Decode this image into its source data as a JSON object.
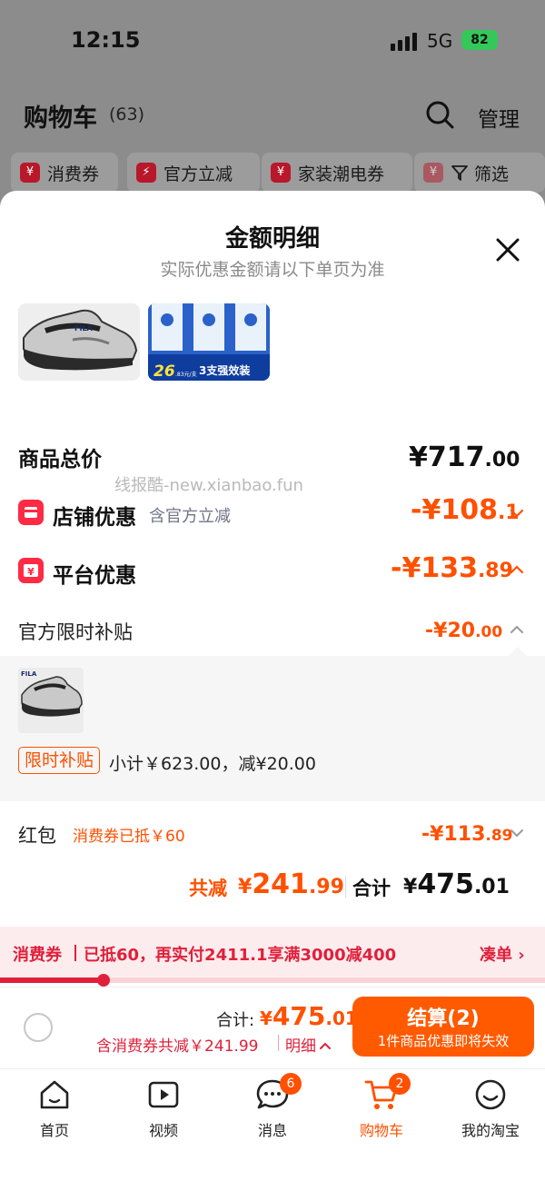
{
  "status_bar": {
    "time": "12:15",
    "network": "5G",
    "battery": "82"
  },
  "cart": {
    "title": "购物车",
    "count": "(63)",
    "manage": "管理",
    "chips": [
      "消费券",
      "官方立减",
      "家装潮电券",
      "筛选"
    ]
  },
  "sheet": {
    "title": "金额明细",
    "subtitle": "实际优惠金额请以下单页为准",
    "tooth_thumb_price": "26",
    "tooth_thumb_unit": ".83元/支",
    "tooth_thumb_caption": "3支强效装"
  },
  "watermark": "线报酷-new.xianbao.fun",
  "goods_total": {
    "label": "商品总价",
    "symbol": "¥",
    "int": "717",
    "dec": ".00"
  },
  "shop_discount": {
    "label": "店铺优惠",
    "note": "含官方立减",
    "prefix": "-¥",
    "int": "108",
    "dec": ".1"
  },
  "platform_discount": {
    "label": "平台优惠",
    "prefix": "-¥",
    "int": "133",
    "dec": ".89"
  },
  "subsidy": {
    "label": "官方限时补贴",
    "prefix": "-¥",
    "int": "20",
    "dec": ".00"
  },
  "subsidy_detail": {
    "tag": "限时补贴",
    "text": "小计￥623.00，减¥20.00"
  },
  "red_packet": {
    "label": "红包",
    "tag": "消费券已抵￥60",
    "prefix": "-¥",
    "int": "113",
    "dec": ".89"
  },
  "summary": {
    "saved_label": "共减",
    "saved_symbol": "¥",
    "saved_int": "241",
    "saved_dec": ".99",
    "total_label": "合计",
    "total_symbol": "¥",
    "total_int": "475",
    "total_dec": ".01"
  },
  "coupon": {
    "name": "消费券",
    "text": "已抵60，再实付2411.1享满3000减400",
    "link": "凑单 ›",
    "progress": 0.19
  },
  "checkout": {
    "total_label": "合计:",
    "total_symbol": "¥",
    "total_int": "475",
    "total_dec": ".01",
    "sub_text": "含消费券共减￥241.99",
    "detail_link": "明细",
    "button_main": "结算(2)",
    "button_sub": "1件商品优惠即将失效"
  },
  "tabs": [
    {
      "label": "首页",
      "icon": "home-icon"
    },
    {
      "label": "视频",
      "icon": "video-icon"
    },
    {
      "label": "消息",
      "icon": "message-icon",
      "badge": "6"
    },
    {
      "label": "购物车",
      "icon": "cart-icon",
      "badge": "2",
      "active": true
    },
    {
      "label": "我的淘宝",
      "icon": "profile-icon"
    }
  ],
  "colors": {
    "accent": "#ff5000",
    "coupon_red": "#e0203a",
    "icon_red": "#ff2a44"
  }
}
